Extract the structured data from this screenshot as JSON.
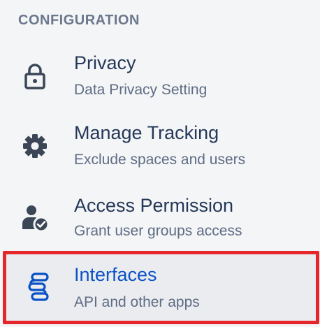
{
  "section": {
    "title": "CONFIGURATION"
  },
  "items": [
    {
      "title": "Privacy",
      "subtitle": "Data Privacy Setting",
      "icon": "lock-icon"
    },
    {
      "title": "Manage Tracking",
      "subtitle": "Exclude spaces and users",
      "icon": "gear-icon"
    },
    {
      "title": "Access Permission",
      "subtitle": "Grant user groups access",
      "icon": "user-check-icon"
    },
    {
      "title": "Interfaces",
      "subtitle": "API and other apps",
      "icon": "interfaces-icon",
      "active": true
    }
  ],
  "colors": {
    "accent": "#0b52c5",
    "highlight_border": "#e5262a",
    "icon": "#3b4656"
  }
}
